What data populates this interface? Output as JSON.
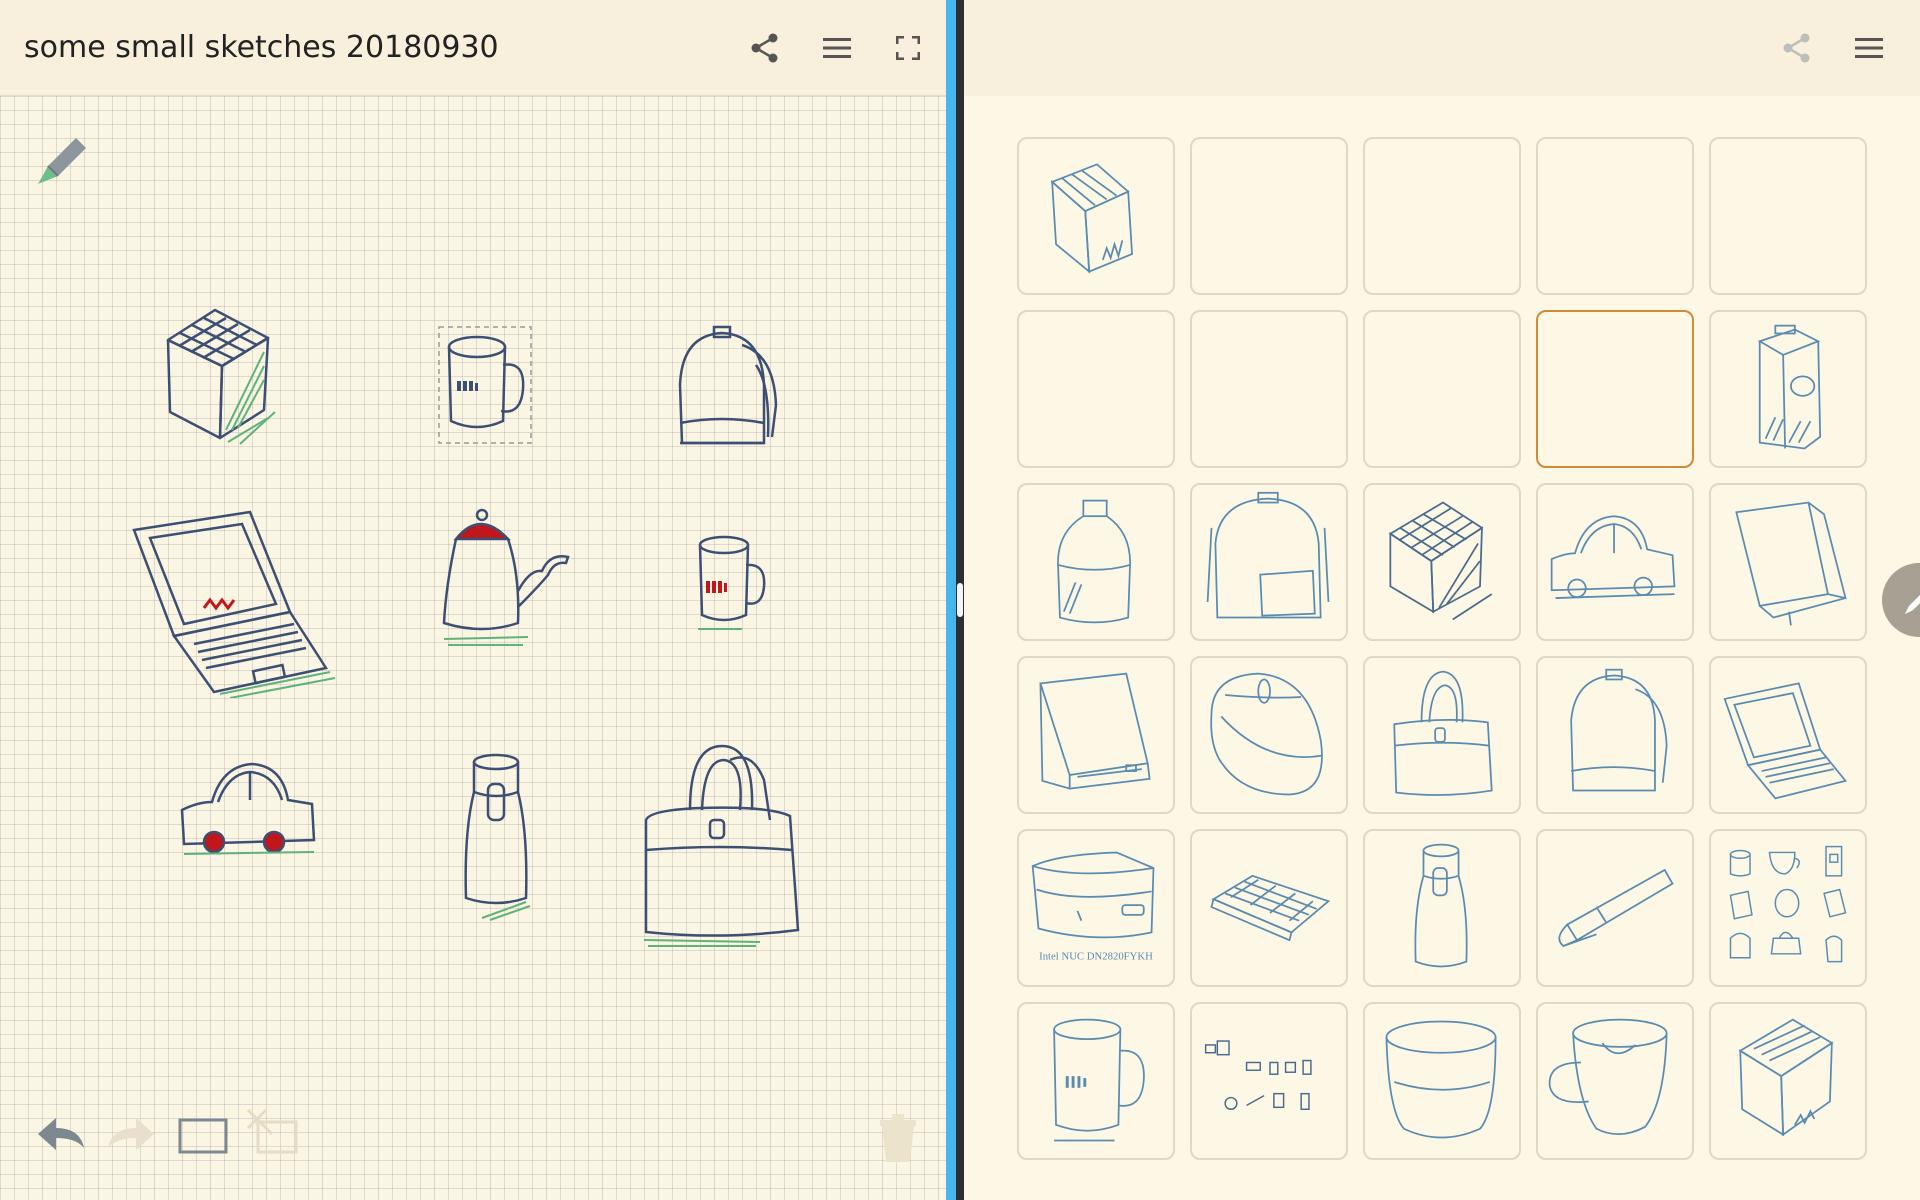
{
  "left": {
    "title": "some small sketches 20180930",
    "header_icons": [
      "share-icon",
      "menu-icon",
      "fullscreen-icon"
    ],
    "tools": [
      "pencil-icon"
    ],
    "bottom_tools": [
      "undo-icon",
      "redo-icon",
      "rectangle-select-icon",
      "lasso-select-icon",
      "trash-icon"
    ]
  },
  "right": {
    "header_icons": [
      "share-icon",
      "menu-icon"
    ],
    "tiles": [
      {
        "content": "box-sketch"
      },
      {
        "content": "empty"
      },
      {
        "content": "empty"
      },
      {
        "content": "empty"
      },
      {
        "content": "empty"
      },
      {
        "content": "empty"
      },
      {
        "content": "empty"
      },
      {
        "content": "empty"
      },
      {
        "content": "empty",
        "selected": true
      },
      {
        "content": "milk-carton-sketch"
      },
      {
        "content": "bottle-sketch"
      },
      {
        "content": "backpack-sketch"
      },
      {
        "content": "cube-sketch"
      },
      {
        "content": "car-sketch"
      },
      {
        "content": "book-sketch"
      },
      {
        "content": "box2-sketch"
      },
      {
        "content": "mouse-sketch"
      },
      {
        "content": "handbag-sketch"
      },
      {
        "content": "backpack2-sketch"
      },
      {
        "content": "laptop-sketch"
      },
      {
        "content": "nuc-sketch",
        "caption": "Intel NUC  DN2820FYKH"
      },
      {
        "content": "keyboard-sketch"
      },
      {
        "content": "thermos-sketch"
      },
      {
        "content": "pen-sketch"
      },
      {
        "content": "collection-sketch"
      },
      {
        "content": "mug-sketch"
      },
      {
        "content": "items-sketch"
      },
      {
        "content": "bowl-sketch"
      },
      {
        "content": "cup-sketch"
      },
      {
        "content": "box3-sketch"
      }
    ],
    "fab_icon": "edit-pencil-icon"
  },
  "colors": {
    "accent_divider": "#46b7ee",
    "sketch_ink": "#3d4f73",
    "thumb_ink": "#5a8bb0",
    "green_shade": "#5fb27a",
    "red_accent": "#c0171c",
    "selected_border": "#d08a3a"
  }
}
